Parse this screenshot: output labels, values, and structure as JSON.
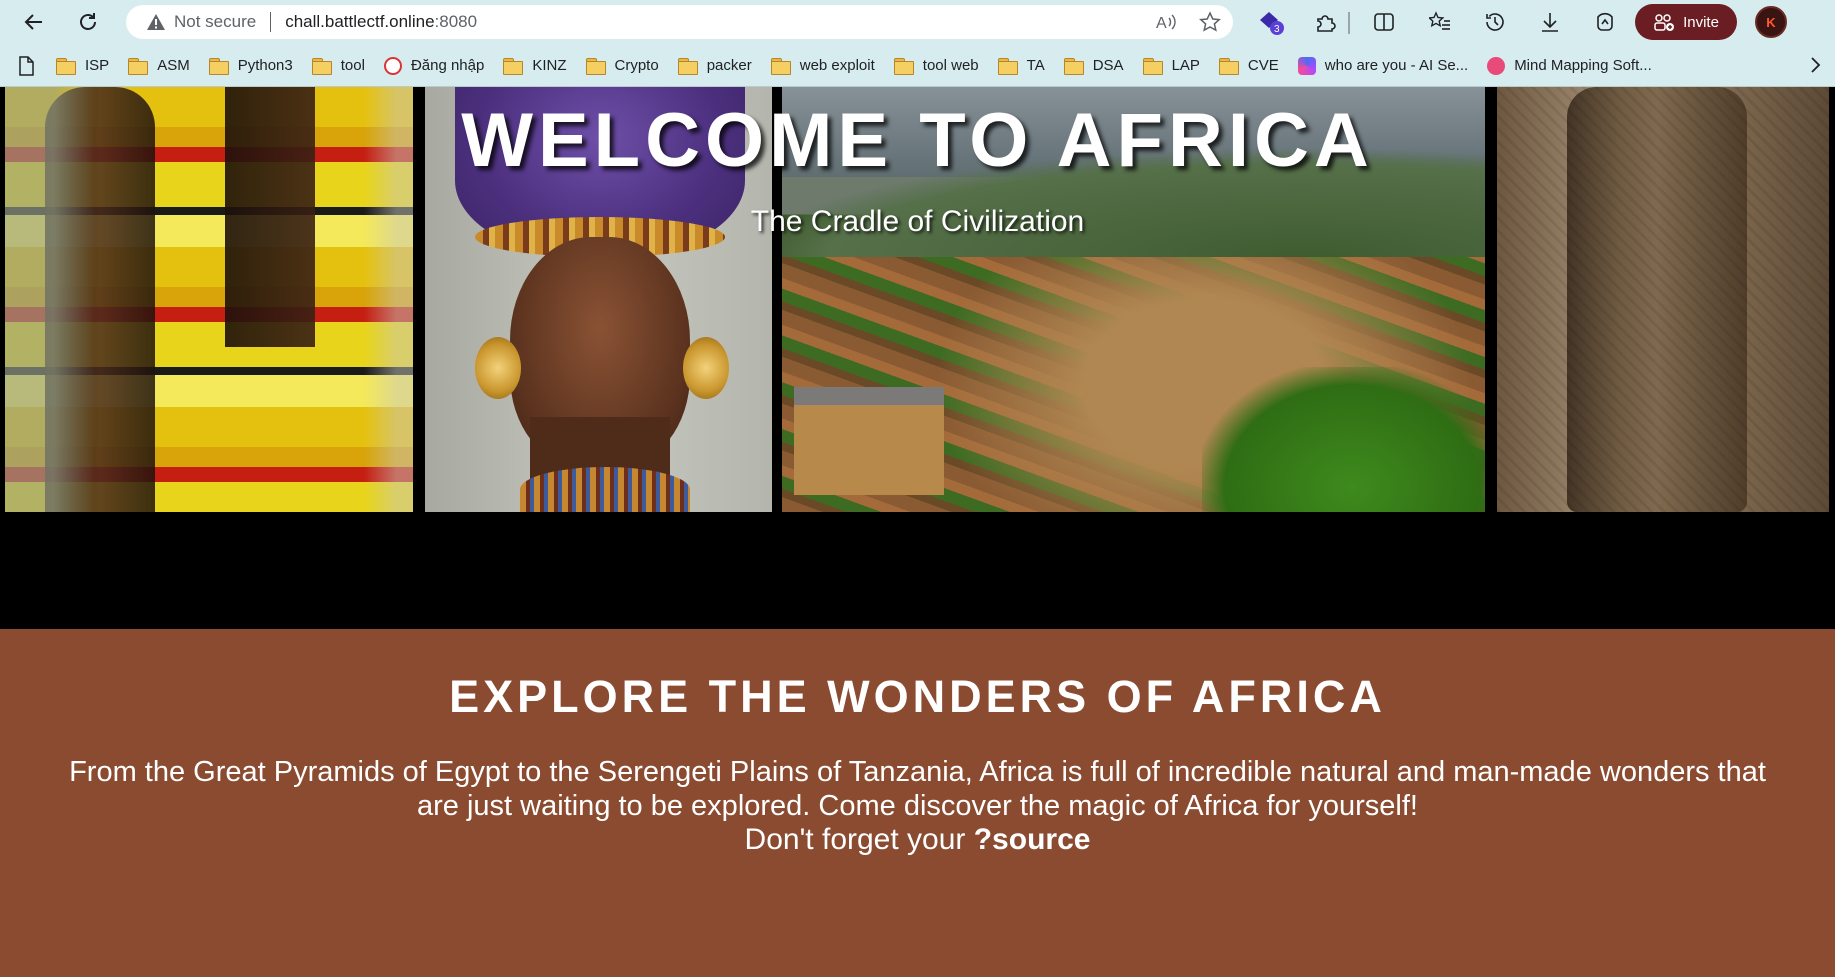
{
  "browser": {
    "security_label": "Not secure",
    "url_host": "chall.battlectf.online",
    "url_port": ":8080",
    "extension_badge": "3",
    "invite_label": "Invite",
    "avatar_initials": "K",
    "bookmarks": [
      {
        "label": "ISP",
        "icon": "folder-icon"
      },
      {
        "label": "ASM",
        "icon": "folder-icon"
      },
      {
        "label": "Python3",
        "icon": "folder-icon"
      },
      {
        "label": "tool",
        "icon": "folder-icon"
      },
      {
        "label": "Đăng nhập",
        "icon": "site-icon"
      },
      {
        "label": "KINZ",
        "icon": "folder-icon"
      },
      {
        "label": "Crypto",
        "icon": "folder-icon"
      },
      {
        "label": "packer",
        "icon": "folder-icon"
      },
      {
        "label": "web exploit",
        "icon": "folder-icon"
      },
      {
        "label": "tool web",
        "icon": "folder-icon"
      },
      {
        "label": "TA",
        "icon": "folder-icon"
      },
      {
        "label": "DSA",
        "icon": "folder-icon"
      },
      {
        "label": "LAP",
        "icon": "folder-icon"
      },
      {
        "label": "CVE",
        "icon": "folder-icon"
      },
      {
        "label": "who are you - AI Se...",
        "icon": "site-icon"
      },
      {
        "label": "Mind Mapping Soft...",
        "icon": "site-icon"
      }
    ]
  },
  "hero": {
    "title": "WELCOME TO AFRICA",
    "subtitle": "The Cradle of Civilization"
  },
  "explore": {
    "heading": "EXPLORE THE WONDERS OF AFRICA",
    "description": "From the Great Pyramids of Egypt to the Serengeti Plains of Tanzania, Africa is full of incredible natural and man-made wonders that are just waiting to be explored. Come discover the magic of Africa for yourself!",
    "hint_prefix": "Don't forget your ",
    "hint_strong": "?source"
  },
  "colors": {
    "chrome": "#d6ecef",
    "explore_bg": "#8a4b31",
    "invite_bg": "#6b1d24"
  }
}
